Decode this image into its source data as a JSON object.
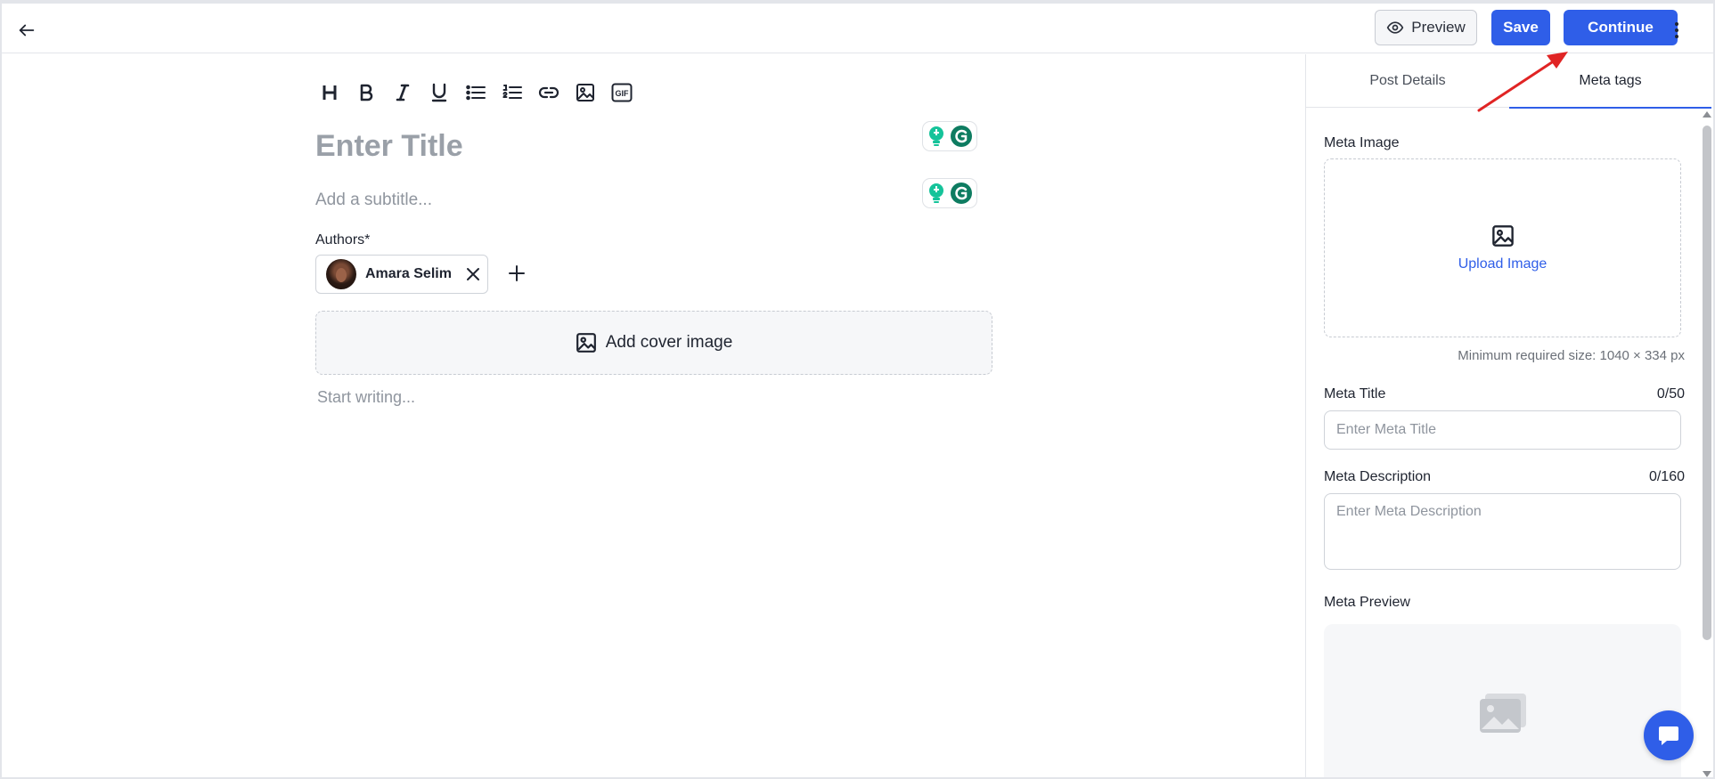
{
  "header": {
    "preview_label": "Preview",
    "save_label": "Save",
    "continue_label": "Continue",
    "accent_color": "#2f5ee8"
  },
  "icons": {
    "back": "arrow-left-icon",
    "preview": "eye-icon",
    "more": "kebab-vertical-icon",
    "toolbar": [
      "heading-icon",
      "bold-icon",
      "italic-icon",
      "underline-icon",
      "bullet-list-icon",
      "numbered-list-icon",
      "link-icon",
      "image-icon",
      "gif-icon"
    ]
  },
  "editor": {
    "title_placeholder": "Enter Title",
    "subtitle_placeholder": "Add a subtitle...",
    "authors_label": "Authors*",
    "authors": [
      {
        "name": "Amara Selim"
      }
    ],
    "cover_label": "Add cover image",
    "body_placeholder": "Start writing..."
  },
  "sidebar": {
    "tabs": [
      {
        "label": "Post Details"
      },
      {
        "label": "Meta tags",
        "active": true
      }
    ],
    "meta_image_label": "Meta Image",
    "upload_label": "Upload Image",
    "min_size_text": "Minimum required size: 1040 × 334 px",
    "meta_title_label": "Meta Title",
    "meta_title_count": "0/50",
    "meta_title_placeholder": "Enter Meta Title",
    "meta_desc_label": "Meta Description",
    "meta_desc_count": "0/160",
    "meta_desc_placeholder": "Enter Meta Description",
    "meta_preview_label": "Meta Preview"
  }
}
